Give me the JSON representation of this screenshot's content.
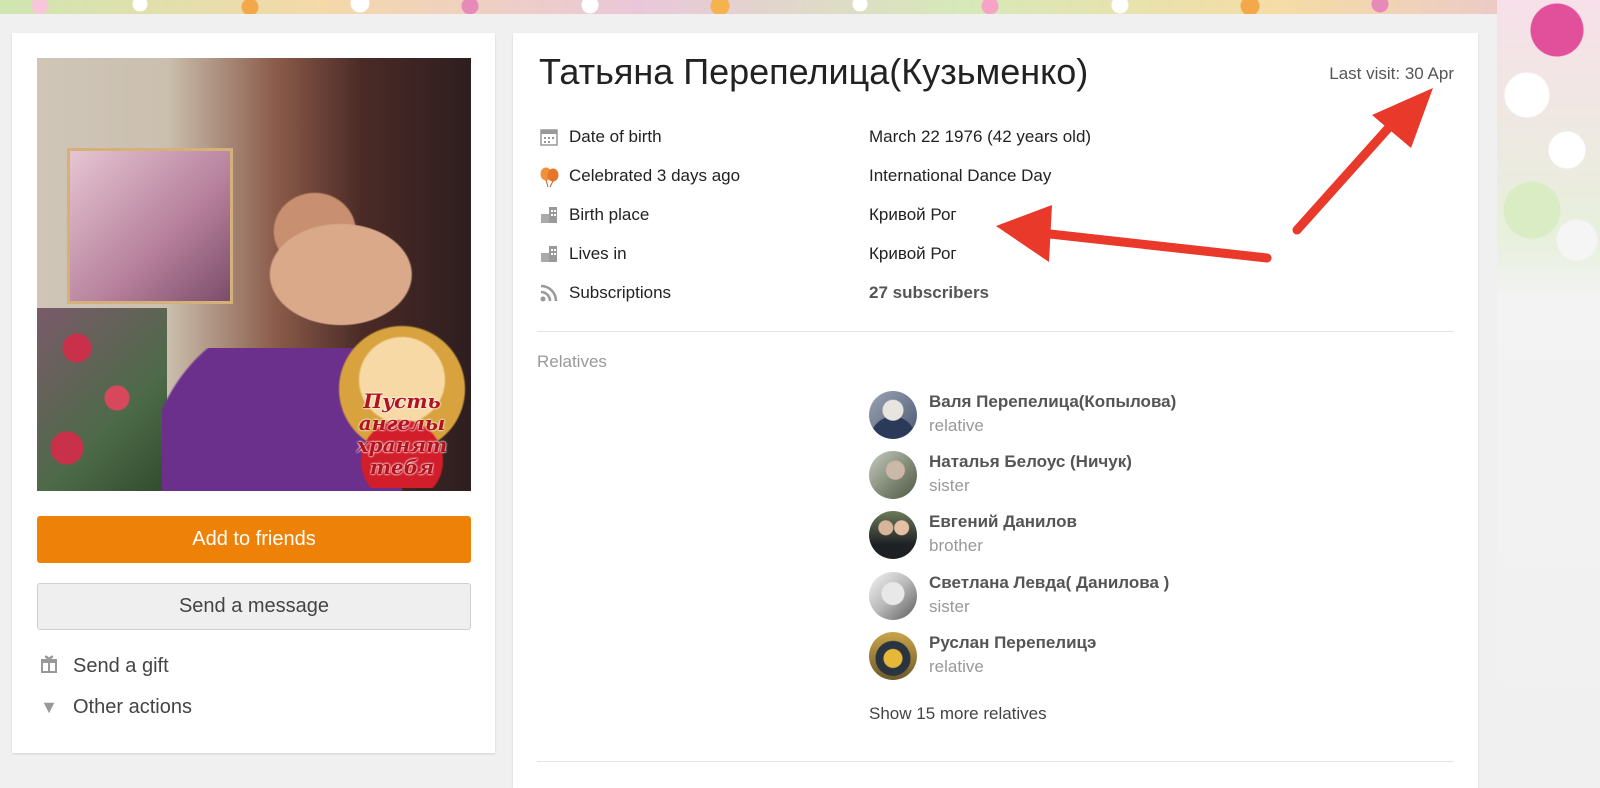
{
  "profile": {
    "name": "Татьяна Перепелица(Кузьменко)",
    "last_visit": "Last visit: 30 Apr",
    "photo_caption": "Пусть ангелы хранят тебя"
  },
  "actions": {
    "add_friends": "Add to friends",
    "send_message": "Send a message",
    "send_gift": "Send a gift",
    "other_actions": "Other actions"
  },
  "info": [
    {
      "icon": "calendar-icon",
      "label": "Date of birth",
      "value": "March 22 1976 (42 years old)"
    },
    {
      "icon": "balloons-icon",
      "label": "Celebrated 3 days ago",
      "value": "International Dance Day"
    },
    {
      "icon": "building-icon",
      "label": "Birth place",
      "value": "Кривой Рог"
    },
    {
      "icon": "building-icon",
      "label": "Lives in",
      "value": "Кривой Рог"
    },
    {
      "icon": "rss-icon",
      "label": "Subscriptions",
      "value": "27 subscribers"
    }
  ],
  "relatives_section": {
    "title": "Relatives",
    "items": [
      {
        "name": "Валя Перепелица(Копылова)",
        "role": "relative"
      },
      {
        "name": "Наталья Белоус (Ничук)",
        "role": "sister"
      },
      {
        "name": "Евгений Данилов",
        "role": "brother"
      },
      {
        "name": "Светлана Левда( Данилова )",
        "role": "sister"
      },
      {
        "name": "Руслан Перепелицэ",
        "role": "relative"
      }
    ],
    "show_more": "Show 15 more relatives"
  },
  "colors": {
    "accent": "#ee8208",
    "annotation_arrow": "#e8392a"
  }
}
